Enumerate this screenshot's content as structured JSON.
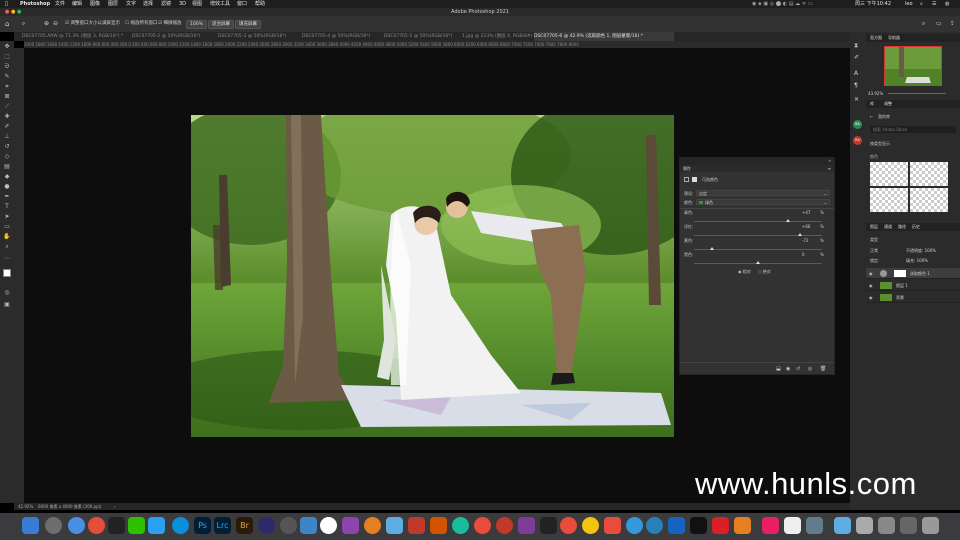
{
  "menubar": {
    "apple": "",
    "app": "Photoshop",
    "items": [
      "文件",
      "编辑",
      "图像",
      "图层",
      "文字",
      "选择",
      "滤镜",
      "3D",
      "视图",
      "增效工具",
      "窗口",
      "帮助"
    ],
    "clock": "周三 下午10:42",
    "user": "leo"
  },
  "window": {
    "title": "Adobe Photoshop 2021"
  },
  "options": {
    "checkbox1": "调整窗口大小以满屏显示",
    "checkbox2": "缩放所有窗口",
    "checkbox3": "细微缩放",
    "zoom": "100%",
    "fit": "适合屏幕",
    "fill": "填充屏幕"
  },
  "tabs": [
    "DSC07705.ARW @ 71.3% (图层 3, RGB/16*) *",
    "DSC07705-2 @ 50%(RGB/16*)",
    "DSC07705-3 @ 50%(RGB/16*)",
    "DSC07705-4 @ 50%(RGB/16*)",
    "DSC07705-5 @ 50%(RGB/16*)",
    "1.jpg @ 223% (图层 4, RGB/8#) *",
    "DSC07705-6 @ 42.9% (选取颜色 1, 图层蒙版/16) *"
  ],
  "ruler": "2000 1800 1600 1400 1200 1000 800 600 400 200 0 200 400 600 800 1000 1200 1400 1600 1800 2000 2200 2400 2600 2800 3000 3200 3400 3600 3800 4000 4200 4400 4600 4800 5000 5200 5400 5600 5800 6000 6200 6400 6600 6800 7000 7200 7400 7600 7800 8000",
  "properties": {
    "tab": "属性",
    "title": "可选颜色",
    "preset_label": "预设:",
    "preset_value": "自定",
    "color_label": "颜色:",
    "color_value": "绿色",
    "sliders": [
      {
        "label": "青色:",
        "value": "+47",
        "pct": 73.5
      },
      {
        "label": "洋红:",
        "value": "+66",
        "pct": 83
      },
      {
        "label": "黄色:",
        "value": "-72",
        "pct": 14
      },
      {
        "label": "黑色:",
        "value": "0",
        "pct": 50
      }
    ],
    "unit": "%",
    "radio_relative": "相对",
    "radio_absolute": "绝对"
  },
  "navigator": {
    "tab1": "直方图",
    "tab2": "导航器",
    "zoom": "43.92%"
  },
  "libraries": {
    "tab1": "库",
    "tab2": "调整",
    "back": "我的库",
    "search": "搜索 Adobe Stock",
    "view": "按类型显示",
    "colors": "颜色"
  },
  "layers_panel": {
    "tabs": [
      "图层",
      "通道",
      "路径",
      "历史"
    ],
    "kind": "类型",
    "mode": "正常",
    "opacity": "不透明度: 100%",
    "lock": "锁定:",
    "fill": "填充: 100%",
    "layers": [
      {
        "name": "选取颜色 1"
      },
      {
        "name": "图层 1"
      },
      {
        "name": "背景"
      }
    ]
  },
  "status": {
    "zoom": "42.92%",
    "info": "6000 像素 x 4000 像素 (300 ppi)"
  },
  "watermark": "www.hunls.com",
  "colors": {
    "accent": "#2d8ceb",
    "grass": "#4e8a2a",
    "panel": "#323232"
  }
}
